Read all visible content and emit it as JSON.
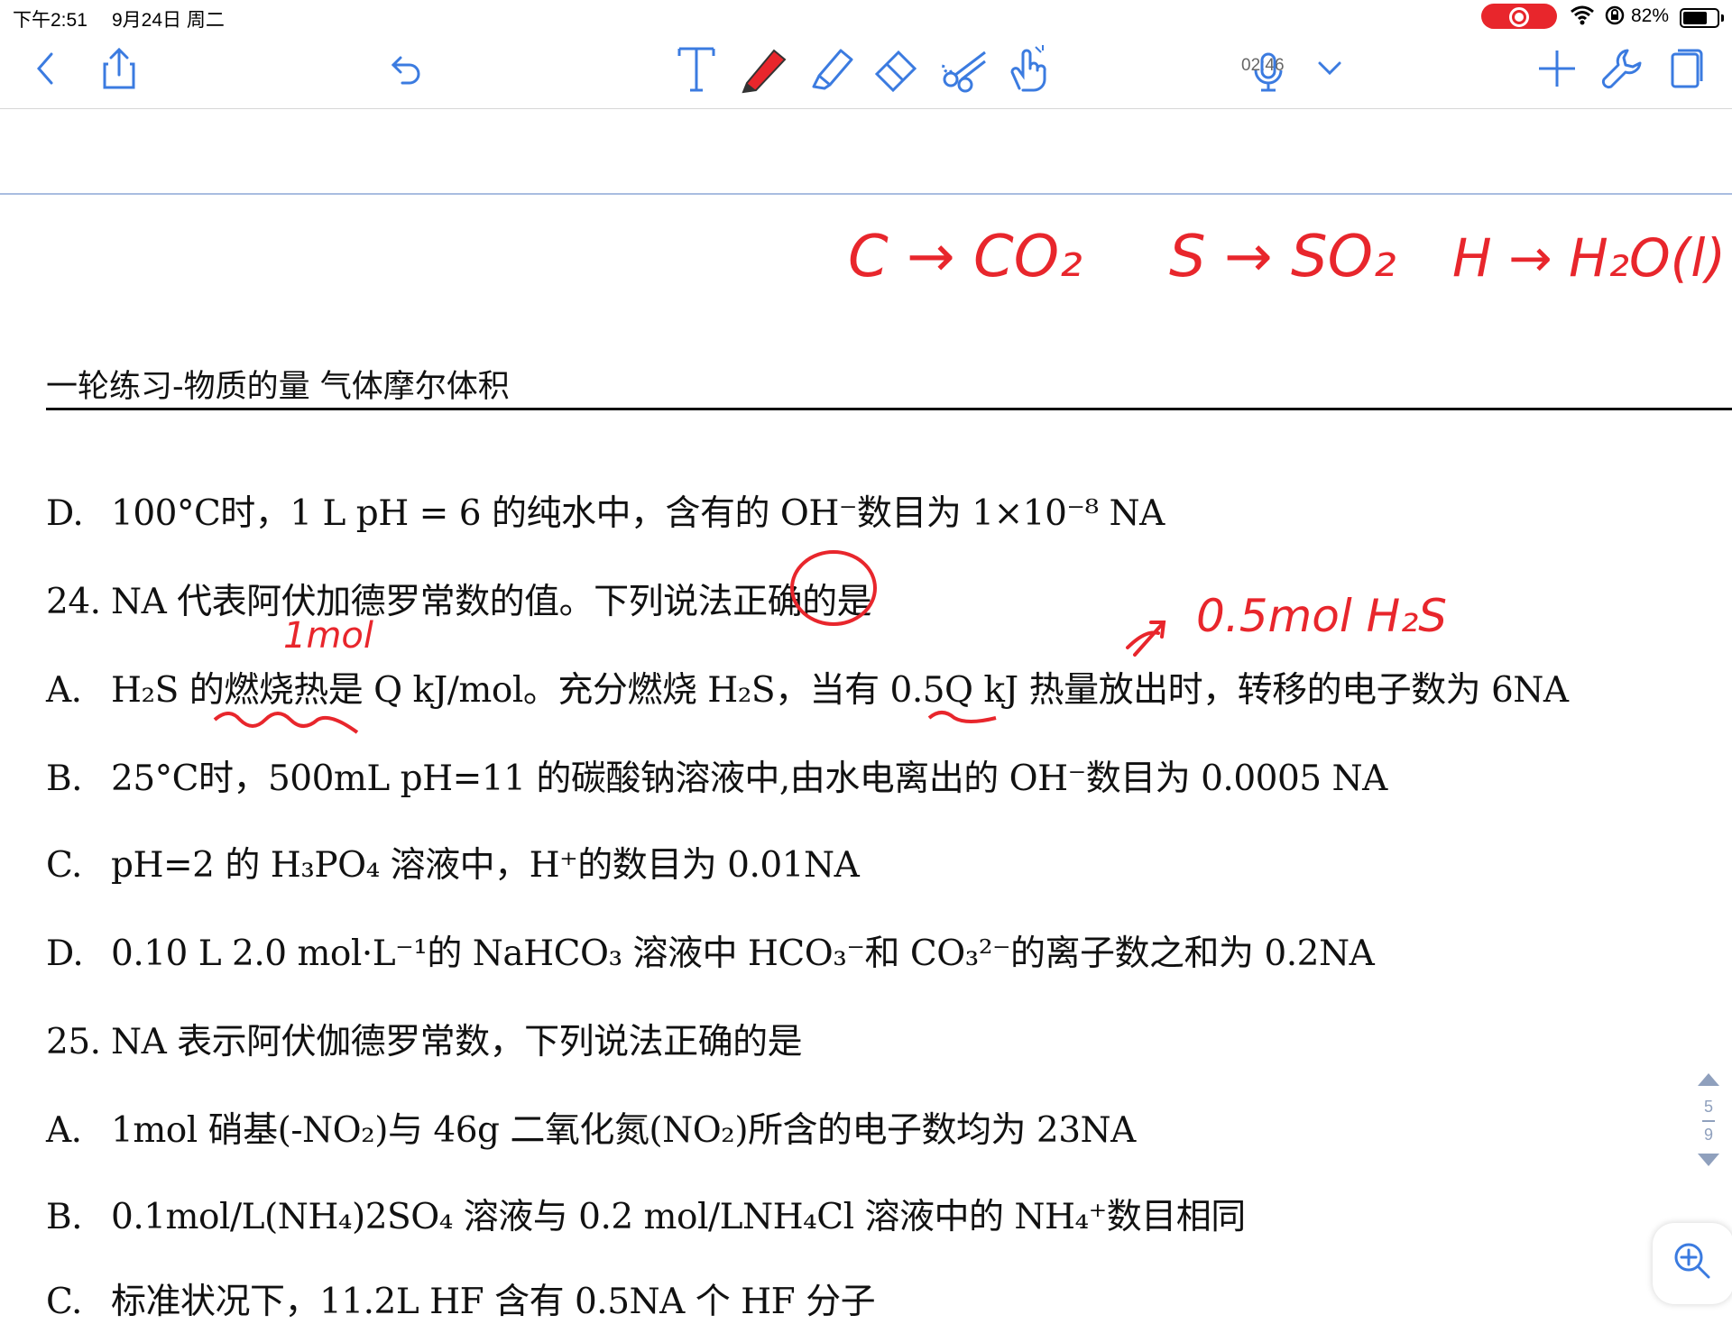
{
  "status_bar": {
    "time": "下午2:51",
    "date": "9月24日 周二",
    "battery_percent_label": "82%",
    "battery_level": 0.82,
    "recording_indicator_color": "#e8262c"
  },
  "toolbar": {
    "recording_time": "02:46",
    "icons": [
      "back-icon",
      "share-icon",
      "undo-icon",
      "text-tool-icon",
      "pen-icon",
      "highlighter-icon",
      "eraser-icon",
      "scissors-icon",
      "hand-icon",
      "microphone-icon",
      "chevron-down-icon",
      "add-icon",
      "wrench-icon",
      "page-icon"
    ],
    "accent_color": "#3b7be0"
  },
  "page": {
    "header": "一轮练习-物质的量  气体摩尔体积",
    "lines": [
      {
        "label": "D.",
        "text": "100°C时，1 L pH = 6 的纯水中，含有的 OH⁻数目为 1×10⁻⁸ NA"
      },
      {
        "label": "24.",
        "text": "NA 代表阿伏加德罗常数的值。下列说法正确的是"
      },
      {
        "label": "A.",
        "text": "H₂S 的燃烧热是 Q kJ/mol。充分燃烧 H₂S，当有 0.5Q kJ 热量放出时，转移的电子数为 6NA"
      },
      {
        "label": "B.",
        "text": "25°C时，500mL pH=11 的碳酸钠溶液中,由水电离出的 OH⁻数目为 0.0005 NA"
      },
      {
        "label": "C.",
        "text": "pH=2 的 H₃PO₄ 溶液中，H⁺的数目为 0.01NA"
      },
      {
        "label": "D.",
        "text": "0.10 L 2.0 mol·L⁻¹的 NaHCO₃ 溶液中 HCO₃⁻和 CO₃²⁻的离子数之和为 0.2NA"
      },
      {
        "label": "25.",
        "text": "NA  表示阿伏伽德罗常数，下列说法正确的是"
      },
      {
        "label": "A.",
        "text": "1mol  硝基(-NO₂)与  46g  二氧化氮(NO₂)所含的电子数均为  23NA"
      },
      {
        "label": "B.",
        "text": "0.1mol/L(NH₄)2SO₄  溶液与  0.2 mol/LNH₄Cl  溶液中的  NH₄⁺数目相同"
      },
      {
        "label": "C.",
        "text": "标准状况下，11.2L HF  含有  0.5NA  个  HF  分子"
      }
    ]
  },
  "handwriting": {
    "color": "#e8262c",
    "top_notes": [
      "C → CO₂",
      "S → SO₂",
      "H → H₂O(l)"
    ],
    "note_1mol": "1mol",
    "note_h2s": "0.5mol H₂S"
  },
  "pager": {
    "current": "5",
    "total": "9"
  }
}
